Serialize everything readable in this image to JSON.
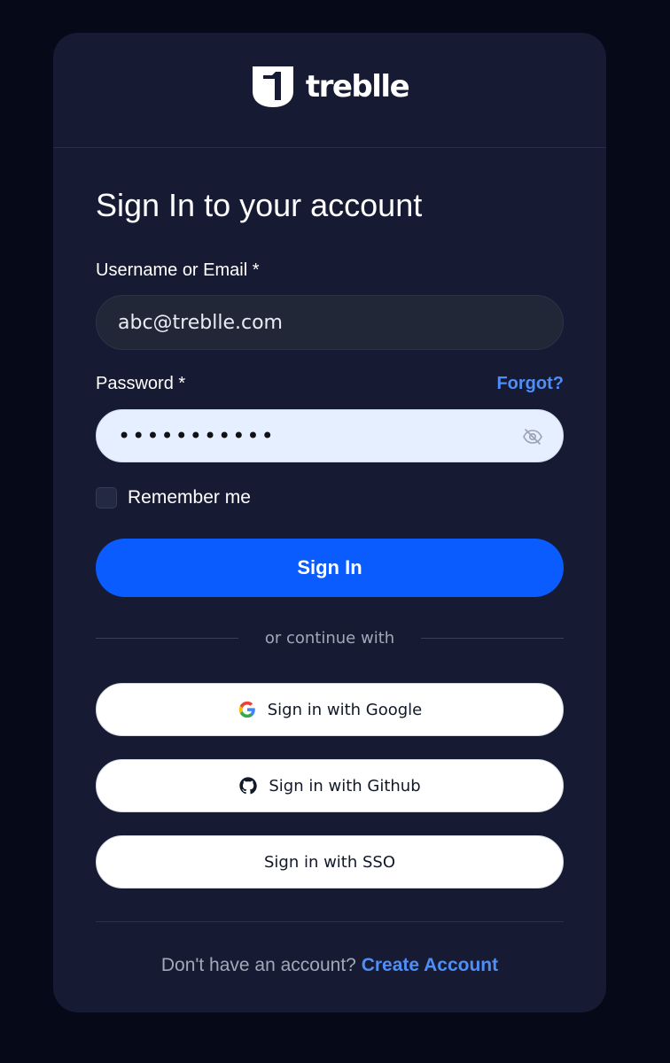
{
  "brand": {
    "name": "treblle"
  },
  "form": {
    "title": "Sign In to your account",
    "username_label": "Username or Email *",
    "username_value": "abc@treblle.com",
    "password_label": "Password *",
    "forgot_label": "Forgot?",
    "password_value": "•••••••••••",
    "remember_label": "Remember me",
    "submit_label": "Sign In"
  },
  "divider": {
    "text": "or continue with"
  },
  "social": {
    "google_label": "Sign in with Google",
    "github_label": "Sign in with Github",
    "sso_label": "Sign in with SSO"
  },
  "footer": {
    "prompt": "Don't have an account?",
    "link_label": "Create Account"
  },
  "colors": {
    "background": "#050918",
    "card": "#161b33",
    "primary": "#0a5cff",
    "link": "#4f8ef7"
  }
}
